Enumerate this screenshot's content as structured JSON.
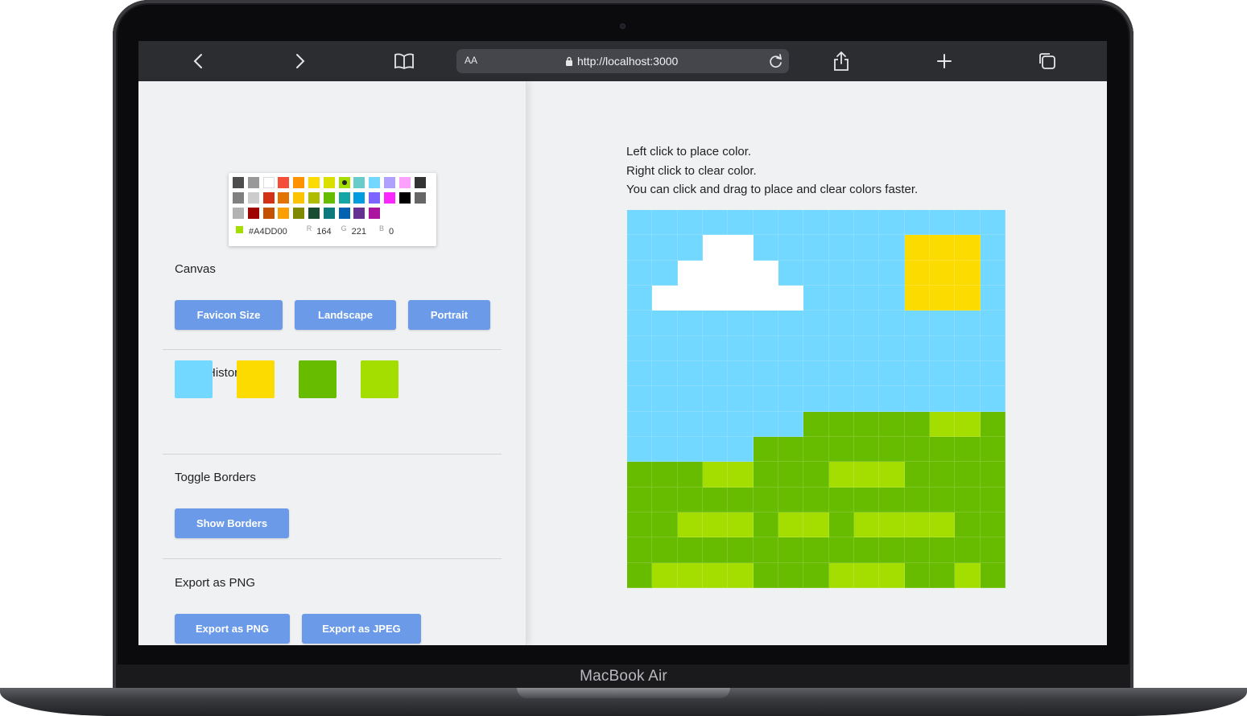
{
  "device": {
    "label": "MacBook Air"
  },
  "browser": {
    "text_size_label": "AA",
    "url": "http://localhost:3000"
  },
  "color_picker": {
    "rows": [
      [
        "#4d4d4d",
        "#999999",
        "#ffffff",
        "#f44e3b",
        "#fe9200",
        "#fcdc00",
        "#dbdf00",
        "#a4dd00",
        "#68ccca",
        "#73d8ff",
        "#aea1ff",
        "#fda1ff",
        "#333333"
      ],
      [
        "#808080",
        "#cccccc",
        "#d33115",
        "#e27300",
        "#fcc400",
        "#b0bc00",
        "#68bc00",
        "#16a5a5",
        "#009ce0",
        "#7b64ff",
        "#fa28ff",
        "#000000",
        "#666666"
      ],
      [
        "#b3b3b3",
        "#9f0500",
        "#c45100",
        "#fb9e00",
        "#808900",
        "#194d33",
        "#0c797d",
        "#0062b1",
        "#653294",
        "#ab149e"
      ]
    ],
    "selected": "#a4dd00",
    "hex": "#A4DD00",
    "r_label": "R",
    "r": "164",
    "g_label": "G",
    "g": "221",
    "b_label": "B",
    "b": "0"
  },
  "canvas_section": {
    "title": "Canvas",
    "buttons": [
      "Favicon Size",
      "Landscape",
      "Portrait"
    ]
  },
  "history_section": {
    "title": "Color History",
    "colors": [
      "#73d8ff",
      "#fcdc00",
      "#68bc00",
      "#a4dd00"
    ]
  },
  "borders_section": {
    "title": "Toggle Borders",
    "button": "Show Borders"
  },
  "export_section": {
    "title": "Export as PNG",
    "buttons": [
      "Export as PNG",
      "Export as JPEG"
    ]
  },
  "instructions": [
    "Left click to place color.",
    "Right click to clear color.",
    "You can click and drag to place and clear colors faster."
  ],
  "pixel_grid": {
    "palette": {
      "S": "#73d8ff",
      "W": "#ffffff",
      "Y": "#fcdc00",
      "G": "#68bc00",
      "L": "#a4dd00"
    },
    "rows": [
      "SSSSSSSSSSSSSSS",
      "SSSWWSSSSSSYYYS",
      "SSWWWWSSSSSYYYS",
      "SWWWWWWSSSSYYYS",
      "SSSSSSSSSSSSSSS",
      "SSSSSSSSSSSSSSS",
      "SSSSSSSSSSSSSSS",
      "SSSSSSSSSSSSSSS",
      "SSSSSSSGGGGGLLG",
      "SSSSSGGGGGGGGGG",
      "GGGLLGGGLLLGGGG",
      "GGGGGGGGGGGGGGG",
      "GGLLLGLLGLLLLGG",
      "GGGGGGGGGGGGGGG",
      "GLLLLGGGLLLGGLG"
    ]
  }
}
